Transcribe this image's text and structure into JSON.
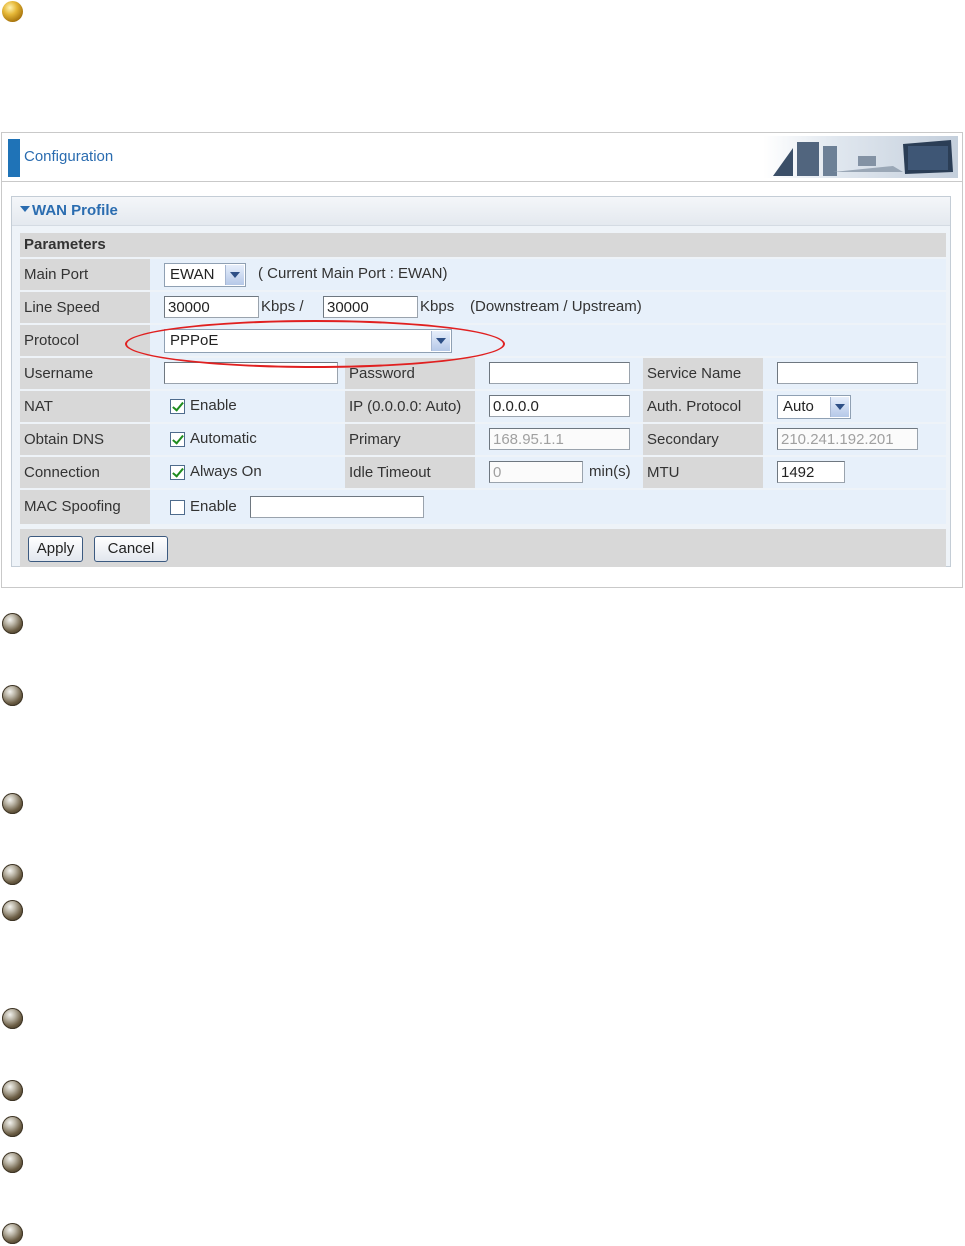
{
  "header": {
    "title": "Configuration"
  },
  "wan_profile": {
    "title": "WAN Profile",
    "params_heading": "Parameters",
    "main_port": {
      "label": "Main Port",
      "value": "EWAN",
      "note": "( Current Main Port : EWAN)"
    },
    "line_speed": {
      "label": "Line Speed",
      "down": "30000",
      "unit1": "Kbps /",
      "up": "30000",
      "unit2": "Kbps",
      "note": "(Downstream / Upstream)"
    },
    "protocol": {
      "label": "Protocol",
      "value": "PPPoE"
    },
    "username": {
      "label": "Username",
      "value": ""
    },
    "password": {
      "label": "Password",
      "value": ""
    },
    "service_name": {
      "label": "Service Name",
      "value": ""
    },
    "nat": {
      "label": "NAT",
      "checkbox_label": "Enable",
      "checked": true
    },
    "ip": {
      "label": "IP (0.0.0.0: Auto)",
      "value": "0.0.0.0"
    },
    "auth_protocol": {
      "label": "Auth. Protocol",
      "value": "Auto"
    },
    "obtain_dns": {
      "label": "Obtain DNS",
      "checkbox_label": "Automatic",
      "checked": true
    },
    "primary": {
      "label": "Primary",
      "value": "168.95.1.1"
    },
    "secondary": {
      "label": "Secondary",
      "value": "210.241.192.201"
    },
    "connection": {
      "label": "Connection",
      "checkbox_label": "Always On",
      "checked": true
    },
    "idle_timeout": {
      "label": "Idle Timeout",
      "value": "0",
      "unit": "min(s)"
    },
    "mtu": {
      "label": "MTU",
      "value": "1492"
    },
    "mac_spoofing": {
      "label": "MAC Spoofing",
      "checkbox_label": "Enable",
      "checked": false,
      "value": ""
    },
    "buttons": {
      "apply": "Apply",
      "cancel": "Cancel"
    }
  },
  "colors": {
    "accent": "#1f73b7",
    "title_text": "#2a6cb0",
    "highlight_ellipse": "#e02020"
  }
}
